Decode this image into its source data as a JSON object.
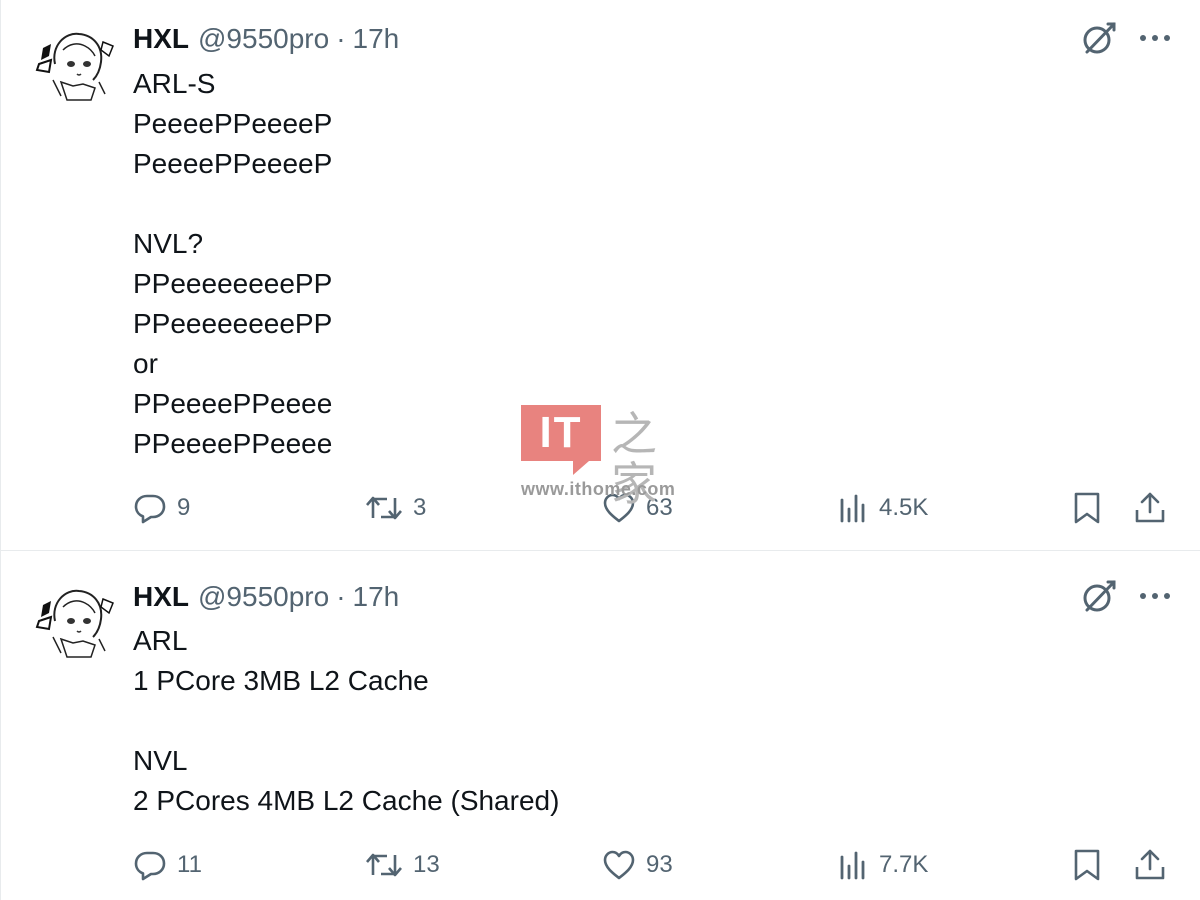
{
  "tweets": [
    {
      "author": {
        "name": "HXL",
        "handle": "@9550pro",
        "separator": "·",
        "time": "17h"
      },
      "lines": [
        "ARL-S",
        "PeeeePPeeeeP",
        "PeeeePPeeeeP",
        "",
        "NVL?",
        "PPeeeeeeeePP",
        "PPeeeeeeeePP",
        "or",
        "PPeeeePPeeee",
        "PPeeeePPeeee"
      ],
      "stats": {
        "replies": "9",
        "retweets": "3",
        "likes": "63",
        "views": "4.5K"
      }
    },
    {
      "author": {
        "name": "HXL",
        "handle": "@9550pro",
        "separator": "·",
        "time": "17h"
      },
      "lines": [
        "ARL",
        "1 PCore 3MB L2 Cache",
        "",
        "NVL",
        "2 PCores 4MB L2 Cache (Shared)"
      ],
      "stats": {
        "replies": "11",
        "retweets": "13",
        "likes": "93",
        "views": "7.7K"
      }
    }
  ],
  "icons": {
    "top": [
      "grok-icon",
      "more-icon"
    ],
    "actions": [
      "reply-icon",
      "retweet-icon",
      "like-icon",
      "views-icon",
      "bookmark-icon",
      "share-icon"
    ]
  },
  "watermark": {
    "logo_text": "IT",
    "cjk_text": "之家",
    "url": "www.ithome.com"
  },
  "colors": {
    "text": "#0f1419",
    "secondary": "#536471",
    "divider": "#e8ebed",
    "watermark_accent": "#e8837f"
  }
}
